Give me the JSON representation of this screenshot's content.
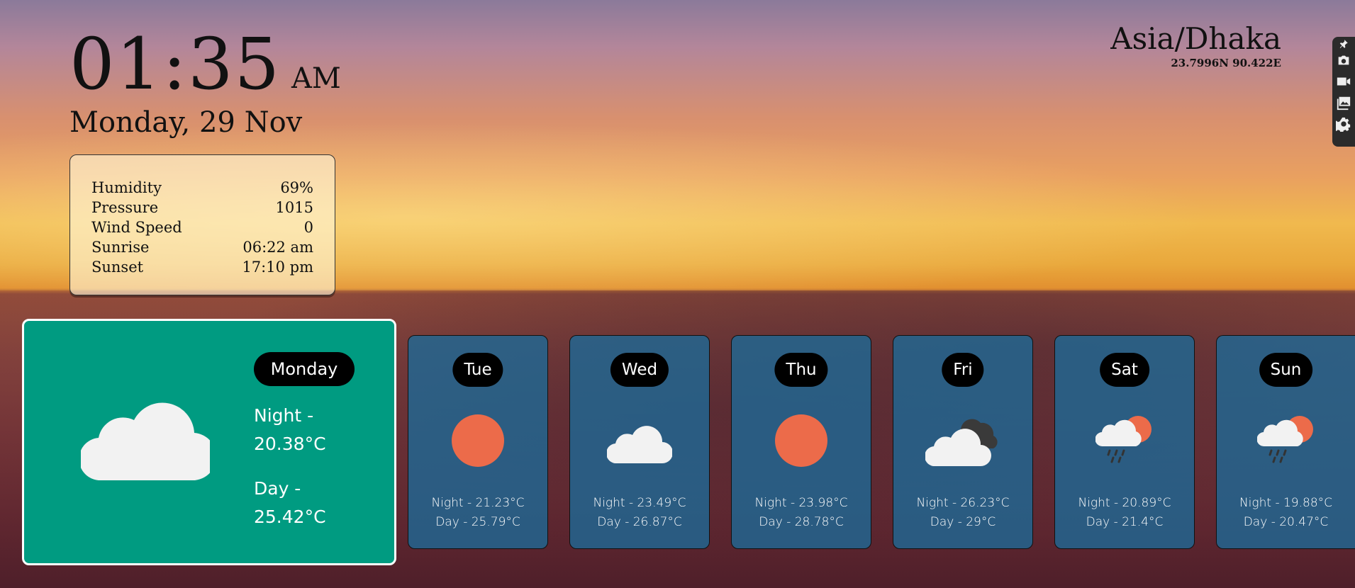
{
  "clock": {
    "time": "01:35",
    "ampm": "AM",
    "date": "Monday, 29 Nov"
  },
  "info": {
    "rows": [
      {
        "label": "Humidity",
        "value": "69%"
      },
      {
        "label": "Pressure",
        "value": "1015"
      },
      {
        "label": "Wind Speed",
        "value": "0"
      },
      {
        "label": "Sunrise",
        "value": "06:22 am"
      },
      {
        "label": "Sunset",
        "value": "17:10 pm"
      }
    ]
  },
  "location": {
    "timezone": "Asia/Dhaka",
    "coords": "23.7996N 90.422E"
  },
  "side_icons": [
    "pin-icon",
    "camera-icon",
    "video-icon",
    "gallery-icon",
    "gear-icon"
  ],
  "today": {
    "day": "Monday",
    "night": "Night - 20.38&#176;C",
    "day_temp": "Day - 25.42&#176;C",
    "icon": "cloud-icon",
    "night_text": "Night -",
    "night_value": "20.38°C",
    "day_text": "Day -",
    "day_value": "25.42°C"
  },
  "forecast": [
    {
      "day": "Tue",
      "icon": "sun-icon",
      "night": "Night - 21.23°C",
      "day_temp": "Day - 25.79°C"
    },
    {
      "day": "Wed",
      "icon": "cloud-icon",
      "night": "Night - 23.49°C",
      "day_temp": "Day - 26.87°C"
    },
    {
      "day": "Thu",
      "icon": "sun-icon",
      "night": "Night - 23.98°C",
      "day_temp": "Day - 28.78°C"
    },
    {
      "day": "Fri",
      "icon": "dark-cloud-icon",
      "night": "Night - 26.23°C",
      "day_temp": "Day - 29°C"
    },
    {
      "day": "Sat",
      "icon": "rain-sun-icon",
      "night": "Night - 20.89°C",
      "day_temp": "Day - 21.4°C"
    },
    {
      "day": "Sun",
      "icon": "rain-sun-icon",
      "night": "Night - 19.88°C",
      "day_temp": "Day - 20.47°C"
    }
  ],
  "colors": {
    "today_card": "#009b81",
    "forecast_card": "#1e6996",
    "sun": "#ec6b4a",
    "cloud": "#f2f2f2"
  }
}
